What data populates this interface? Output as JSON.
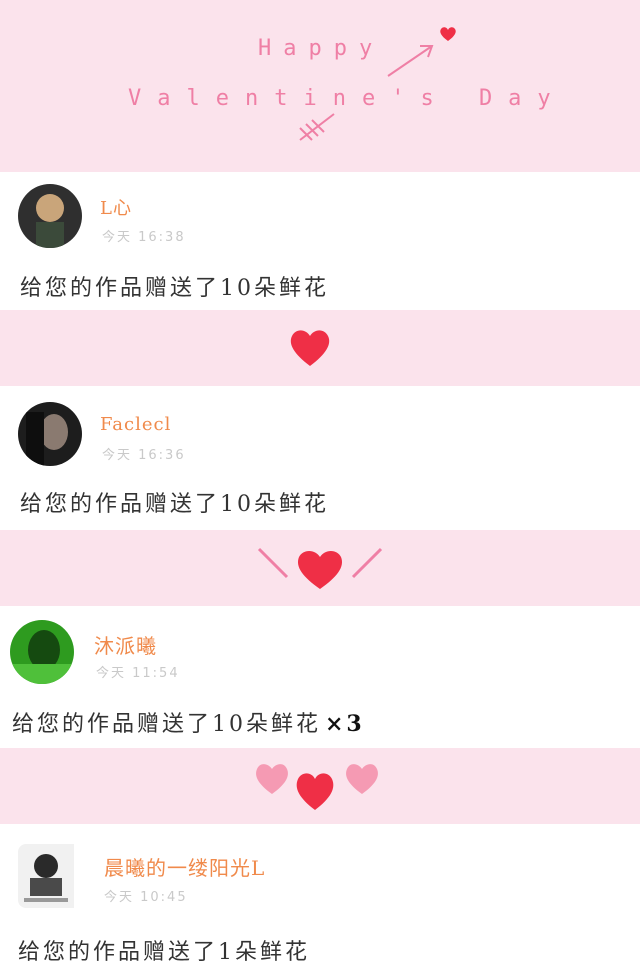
{
  "header": {
    "line1": "Happy",
    "line2": "Valentine's Day"
  },
  "colors": {
    "band_pink": "#fbe3ec",
    "heart_red": "#ef2f46",
    "heart_light": "#f59ab3",
    "username_orange": "#f08a4b"
  },
  "messages": [
    {
      "user": "L心",
      "time": "今天 16:38",
      "text": "给您的作品赠送了10朵鲜花",
      "multiplier": ""
    },
    {
      "user": "Faclecl",
      "time": "今天 16:36",
      "text": "给您的作品赠送了10朵鲜花",
      "multiplier": ""
    },
    {
      "user": "沐派曦",
      "time": "今天 11:54",
      "text": "给您的作品赠送了10朵鲜花",
      "multiplier": "×3"
    },
    {
      "user": "晨曦的一缕阳光L",
      "time": "今天 10:45",
      "text": "给您的作品赠送了1朵鲜花",
      "multiplier": ""
    }
  ],
  "dividers": [
    "heart-icon",
    "heart-with-lines-icon",
    "three-hearts-icon"
  ]
}
